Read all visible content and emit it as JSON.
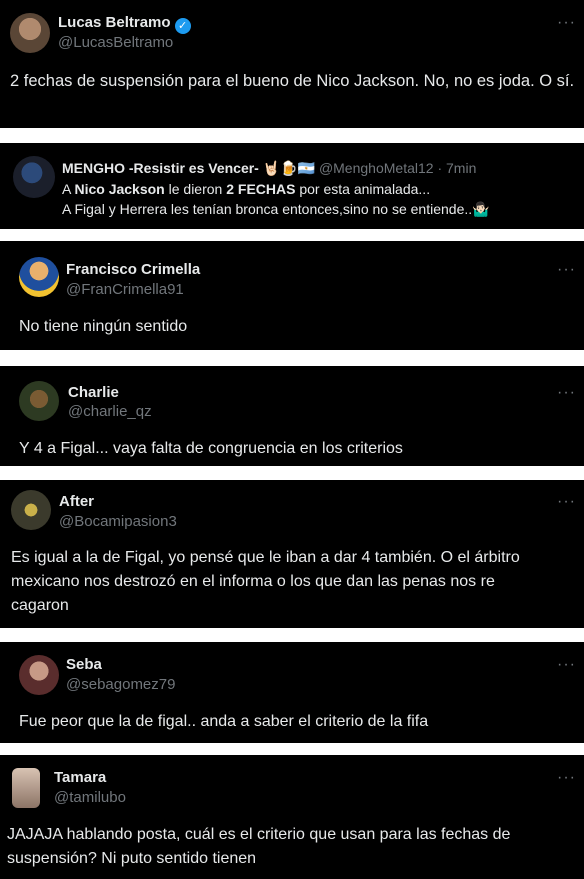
{
  "main_tweet": {
    "name": "Lucas Beltramo",
    "handle": "@LucasBeltramo",
    "text": "2 fechas de suspensión para el bueno de Nico Jackson. No, no es joda. O sí."
  },
  "quoted": {
    "name": "MENGHO -Resistir es Vencer-",
    "emoji": "🤘🏻🍺🇦🇷",
    "handle": "@MenghoMetal12",
    "time": "· 7min",
    "l1_pre": "A ",
    "l1_b1": "Nico Jackson",
    "l1_mid": " le dieron ",
    "l1_b2": "2 FECHAS",
    "l1_post": " por esta animalada...",
    "l2": "A Figal y Herrera les tenían bronca entonces,sino no se entiende..🤷🏻‍♂️"
  },
  "more_label": "···",
  "replies": [
    {
      "name": "Francisco Crimella",
      "handle": "@FranCrimella91",
      "lines": [
        "No tiene ningún sentido"
      ]
    },
    {
      "name": "Charlie",
      "handle": "@charlie_qz",
      "lines": [
        "Y 4 a Figal... vaya falta de congruencia en los criterios"
      ]
    },
    {
      "name": "After",
      "handle": "@Bocamipasion3",
      "lines": [
        "Es igual a la de Figal, yo pensé que le iban a dar 4 también. O el árbitro",
        "mexicano nos destrozó en el informa o los que dan las penas nos re",
        "cagaron"
      ]
    },
    {
      "name": "Seba",
      "handle": "@sebagomez79",
      "lines": [
        "Fue peor que la de figal.. anda a saber el criterio de la fifa"
      ]
    },
    {
      "name": "Tamara",
      "handle": "@tamilubo",
      "lines": [
        "JAJAJA hablando posta, cuál es el criterio que usan para las fechas de",
        "suspensión? Ni puto sentido tienen"
      ]
    }
  ],
  "colors": {
    "background": "#000000",
    "text": "#e7e9ea",
    "secondary": "#71767b",
    "verified": "#1d9bf0"
  }
}
